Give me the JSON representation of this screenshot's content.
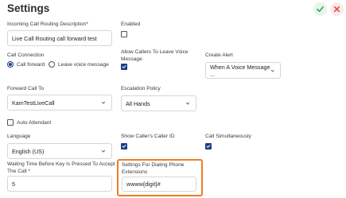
{
  "page": {
    "title": "Settings",
    "confirm_icon": "check-icon",
    "cancel_icon": "close-icon",
    "confirm_color": "#35a853",
    "cancel_color": "#e0504e"
  },
  "fields": {
    "description": {
      "label": "Incoming Call Routing Description*",
      "value": "Live Call Routing call forward test"
    },
    "enabled": {
      "label": "Enabled",
      "checked": false
    },
    "call_connection": {
      "label": "Call Connection",
      "options": [
        {
          "label": "Call forward",
          "selected": true
        },
        {
          "label": "Leave voice message",
          "selected": false
        }
      ]
    },
    "allow_voice_message": {
      "label_line1": "Allow Callers To Leave Voice",
      "label_line2": "Message",
      "checked": true
    },
    "create_alert": {
      "label": "Create Alert",
      "value": "When A Voice Message ..."
    },
    "forward_call_to": {
      "label": "Forward Call To",
      "value": "KamTestLiveCall"
    },
    "escalation_policy": {
      "label": "Escalation Policy",
      "value": "All Hands"
    },
    "auto_attendant": {
      "label": "Auto Attendant",
      "checked": false
    },
    "language": {
      "label": "Language",
      "value": "English (US)"
    },
    "show_callers_id": {
      "label": "Show Caller's Caller ID",
      "checked": true
    },
    "call_simultaneously": {
      "label": "Call Simultaneously",
      "checked": true
    },
    "waiting_time": {
      "label_line1": "Waiting Time Before Key Is Pressed To Accept",
      "label_line2": "The Call *",
      "value": "5"
    },
    "dialing_settings": {
      "label_line1": "Settings For Dialing Phone",
      "label_line2": "Extensions",
      "value": "wwww{digit}#"
    }
  },
  "colors": {
    "accent": "#1a3e8c",
    "highlight": "#ef7d23"
  }
}
